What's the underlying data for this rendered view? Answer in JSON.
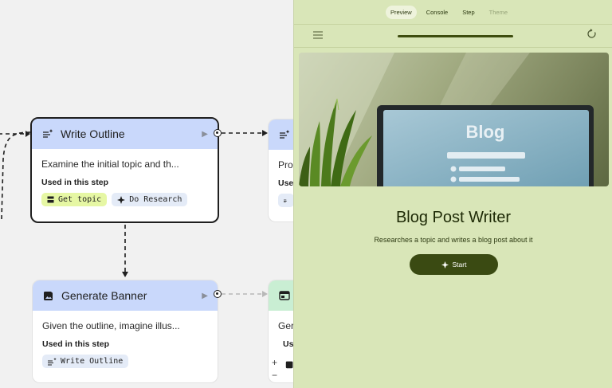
{
  "canvas": {
    "nodes": [
      {
        "title": "Write Outline",
        "description": "Examine the initial topic and th...",
        "used_label": "Used in this step",
        "chips": [
          "Get topic",
          "Do Research"
        ]
      },
      {
        "title": "Generate Banner",
        "description": "Given the outline, imagine illus...",
        "used_label": "Used in this step",
        "chips": [
          "Write Outline"
        ]
      },
      {
        "description": "Pro",
        "used_label": "Use"
      },
      {
        "description": "Ger",
        "used_label": "Use"
      }
    ],
    "zoom": {
      "in": "+",
      "out": "−"
    }
  },
  "preview": {
    "tabs": [
      "Preview",
      "Console",
      "Step",
      "Theme"
    ],
    "active_tab": "Preview",
    "progress": 1.0,
    "banner_text": "Blog",
    "title": "Blog Post Writer",
    "subtitle": "Researches a topic and writes a blog post about it",
    "start_label": "Start"
  },
  "colors": {
    "node_header_blue": "#c9d8fb",
    "node_header_green": "#c9eed3",
    "chip_yellow": "#e6f7a4",
    "chip_blue": "#e4ebf7",
    "preview_bg": "#d9e6b8",
    "accent_dark_olive": "#3a4a12"
  },
  "icons": [
    "text-spark-icon",
    "image-generate-icon",
    "play-icon",
    "menu-icon",
    "refresh-icon",
    "spark-icon",
    "stop-square-icon",
    "web-window-icon"
  ]
}
